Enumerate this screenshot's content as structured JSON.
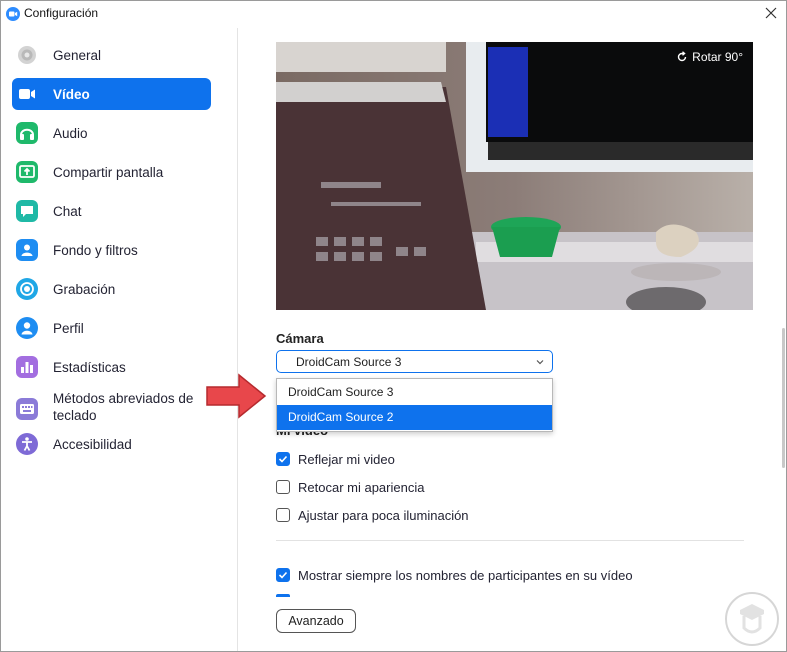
{
  "window": {
    "title": "Configuración"
  },
  "sidebar": {
    "items": [
      {
        "label": "General",
        "icon": "gear-icon",
        "color": "#c7c7c7"
      },
      {
        "label": "Vídeo",
        "icon": "video-icon",
        "color": "#0e72ed",
        "active": true
      },
      {
        "label": "Audio",
        "icon": "headphones-icon",
        "color": "#1fb96b"
      },
      {
        "label": "Compartir pantalla",
        "icon": "share-screen-icon",
        "color": "#1fb96b"
      },
      {
        "label": "Chat",
        "icon": "chat-icon",
        "color": "#1fb9a6"
      },
      {
        "label": "Fondo y filtros",
        "icon": "person-background-icon",
        "color": "#1e8df2"
      },
      {
        "label": "Grabación",
        "icon": "record-icon",
        "color": "#1fa7e6"
      },
      {
        "label": "Perfil",
        "icon": "profile-icon",
        "color": "#1e8df2"
      },
      {
        "label": "Estadísticas",
        "icon": "stats-icon",
        "color": "#a36ee0"
      },
      {
        "label": "Métodos abreviados de",
        "label2": "teclado",
        "icon": "keyboard-icon",
        "color": "#8b7bd8"
      },
      {
        "label": "Accesibilidad",
        "icon": "accessibility-icon",
        "color": "#7e6ad6"
      }
    ]
  },
  "video": {
    "rotate_label": "Rotar 90°",
    "camera_label": "Cámara",
    "camera_selected": "DroidCam Source 3",
    "camera_options": [
      "DroidCam Source 3",
      "DroidCam Source 2"
    ],
    "camera_highlighted_index": 1,
    "my_video_label": "Mi vídeo",
    "checkboxes": [
      {
        "label": "Reflejar mi video",
        "checked": true
      },
      {
        "label": "Retocar mi apariencia",
        "checked": false
      },
      {
        "label": "Ajustar para poca iluminación",
        "checked": false
      },
      {
        "label": "Mostrar siempre los nombres de participantes en su vídeo",
        "checked": true
      }
    ],
    "advanced_button": "Avanzado"
  },
  "colors": {
    "accent": "#0e72ed",
    "arrow": "#e8474b"
  }
}
